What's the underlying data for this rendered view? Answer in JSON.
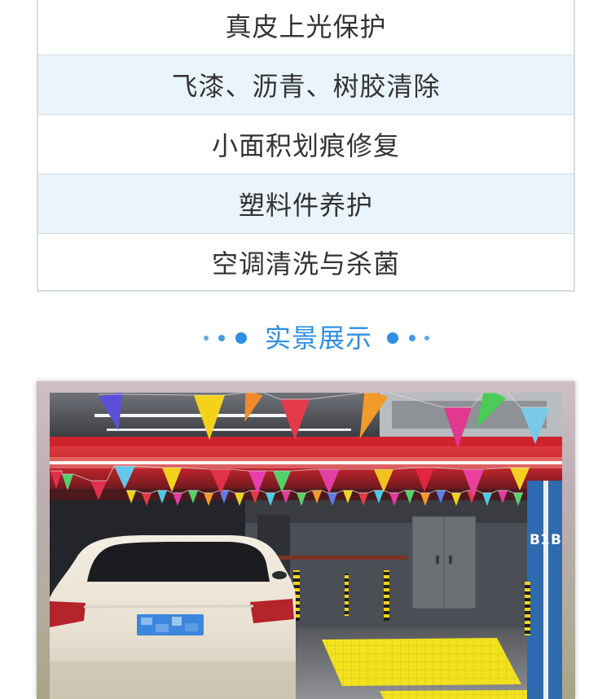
{
  "service_list": {
    "items": [
      {
        "label": "真皮上光保护"
      },
      {
        "label": "飞漆、沥青、树胶清除"
      },
      {
        "label": "小面积划痕修复"
      },
      {
        "label": "塑料件养护"
      },
      {
        "label": "空调清洗与杀菌"
      }
    ]
  },
  "showcase": {
    "title": "实景展示",
    "photo": {
      "pillar_sign": "B1"
    }
  },
  "colors": {
    "accent": "#2e8fe4",
    "row_highlight": "#eaf4fd",
    "text": "#333333",
    "border": "#d6dbe0"
  }
}
